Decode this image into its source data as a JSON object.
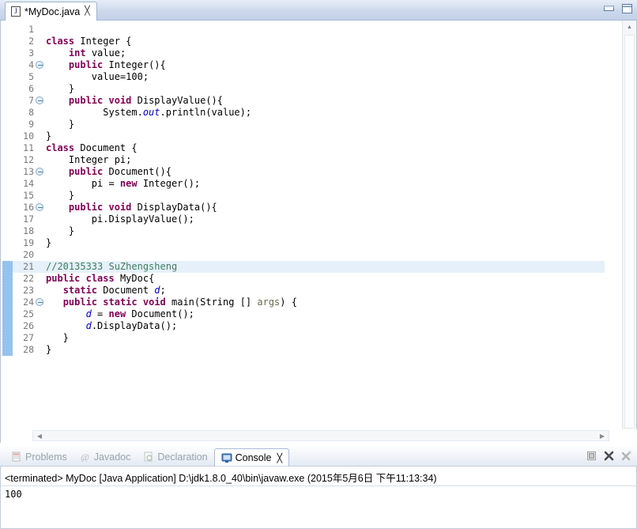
{
  "window": {
    "minimize_label": "minimize-window",
    "maximize_label": "maximize-window"
  },
  "editor_tab": {
    "icon": "java-file-icon",
    "icon_glyph": "J",
    "title": "*MyDoc.java",
    "close_glyph": "╳"
  },
  "editor": {
    "current_line": 21,
    "changed_lines": {
      "from": 21,
      "to": 28
    },
    "folding_markers": [
      4,
      7,
      13,
      16,
      24
    ],
    "line_numbers": [
      1,
      2,
      3,
      4,
      5,
      6,
      7,
      8,
      9,
      10,
      11,
      12,
      13,
      14,
      15,
      16,
      17,
      18,
      19,
      20,
      21,
      22,
      23,
      24,
      25,
      26,
      27,
      28
    ],
    "lines": [
      {
        "n": 1,
        "tokens": []
      },
      {
        "n": 2,
        "tokens": [
          {
            "t": "class",
            "c": "kw"
          },
          {
            "t": " Integer {",
            "c": ""
          }
        ]
      },
      {
        "n": 3,
        "tokens": [
          {
            "t": "    ",
            "c": ""
          },
          {
            "t": "int",
            "c": "kw"
          },
          {
            "t": " value;",
            "c": ""
          }
        ]
      },
      {
        "n": 4,
        "tokens": [
          {
            "t": "    ",
            "c": ""
          },
          {
            "t": "public",
            "c": "kw"
          },
          {
            "t": " Integer(){",
            "c": ""
          }
        ]
      },
      {
        "n": 5,
        "tokens": [
          {
            "t": "        value=100;",
            "c": ""
          }
        ]
      },
      {
        "n": 6,
        "tokens": [
          {
            "t": "    }",
            "c": ""
          }
        ]
      },
      {
        "n": 7,
        "tokens": [
          {
            "t": "    ",
            "c": ""
          },
          {
            "t": "public",
            "c": "kw"
          },
          {
            "t": " ",
            "c": ""
          },
          {
            "t": "void",
            "c": "kw"
          },
          {
            "t": " DisplayValue(){",
            "c": ""
          }
        ]
      },
      {
        "n": 8,
        "tokens": [
          {
            "t": "          System.",
            "c": ""
          },
          {
            "t": "out",
            "c": "fld"
          },
          {
            "t": ".println(value);",
            "c": ""
          }
        ]
      },
      {
        "n": 9,
        "tokens": [
          {
            "t": "    }",
            "c": ""
          }
        ]
      },
      {
        "n": 10,
        "tokens": [
          {
            "t": "}",
            "c": ""
          }
        ]
      },
      {
        "n": 11,
        "tokens": [
          {
            "t": "class",
            "c": "kw"
          },
          {
            "t": " Document {",
            "c": ""
          }
        ]
      },
      {
        "n": 12,
        "tokens": [
          {
            "t": "    Integer pi;",
            "c": ""
          }
        ]
      },
      {
        "n": 13,
        "tokens": [
          {
            "t": "    ",
            "c": ""
          },
          {
            "t": "public",
            "c": "kw"
          },
          {
            "t": " Document(){",
            "c": ""
          }
        ]
      },
      {
        "n": 14,
        "tokens": [
          {
            "t": "        pi = ",
            "c": ""
          },
          {
            "t": "new",
            "c": "kw"
          },
          {
            "t": " Integer();",
            "c": ""
          }
        ]
      },
      {
        "n": 15,
        "tokens": [
          {
            "t": "    }",
            "c": ""
          }
        ]
      },
      {
        "n": 16,
        "tokens": [
          {
            "t": "    ",
            "c": ""
          },
          {
            "t": "public",
            "c": "kw"
          },
          {
            "t": " ",
            "c": ""
          },
          {
            "t": "void",
            "c": "kw"
          },
          {
            "t": " DisplayData(){",
            "c": ""
          }
        ]
      },
      {
        "n": 17,
        "tokens": [
          {
            "t": "        pi.DisplayValue();",
            "c": ""
          }
        ]
      },
      {
        "n": 18,
        "tokens": [
          {
            "t": "    }",
            "c": ""
          }
        ]
      },
      {
        "n": 19,
        "tokens": [
          {
            "t": "}",
            "c": ""
          }
        ]
      },
      {
        "n": 20,
        "tokens": []
      },
      {
        "n": 21,
        "tokens": [
          {
            "t": "//20135333 SuZhengsheng",
            "c": "cmt"
          }
        ]
      },
      {
        "n": 22,
        "tokens": [
          {
            "t": "public",
            "c": "kw"
          },
          {
            "t": " ",
            "c": ""
          },
          {
            "t": "class",
            "c": "kw"
          },
          {
            "t": " MyDoc{",
            "c": ""
          }
        ]
      },
      {
        "n": 23,
        "tokens": [
          {
            "t": "   ",
            "c": ""
          },
          {
            "t": "static",
            "c": "kw"
          },
          {
            "t": " Document ",
            "c": ""
          },
          {
            "t": "d",
            "c": "fld"
          },
          {
            "t": ";",
            "c": ""
          }
        ]
      },
      {
        "n": 24,
        "tokens": [
          {
            "t": "   ",
            "c": ""
          },
          {
            "t": "public",
            "c": "kw"
          },
          {
            "t": " ",
            "c": ""
          },
          {
            "t": "static",
            "c": "kw"
          },
          {
            "t": " ",
            "c": ""
          },
          {
            "t": "void",
            "c": "kw"
          },
          {
            "t": " main(String [] ",
            "c": ""
          },
          {
            "t": "args",
            "c": "par"
          },
          {
            "t": ") {",
            "c": ""
          }
        ]
      },
      {
        "n": 25,
        "tokens": [
          {
            "t": "       ",
            "c": ""
          },
          {
            "t": "d",
            "c": "fld"
          },
          {
            "t": " = ",
            "c": ""
          },
          {
            "t": "new",
            "c": "kw"
          },
          {
            "t": " Document();",
            "c": ""
          }
        ]
      },
      {
        "n": 26,
        "tokens": [
          {
            "t": "       ",
            "c": ""
          },
          {
            "t": "d",
            "c": "fld"
          },
          {
            "t": ".DisplayData();",
            "c": ""
          }
        ]
      },
      {
        "n": 27,
        "tokens": [
          {
            "t": "   }",
            "c": ""
          }
        ]
      },
      {
        "n": 28,
        "tokens": [
          {
            "t": "}",
            "c": ""
          }
        ]
      }
    ]
  },
  "bottom_tabs": [
    {
      "label": "Problems",
      "icon": "problems-icon",
      "active": false
    },
    {
      "label": "Javadoc",
      "icon": "javadoc-icon",
      "active": false
    },
    {
      "label": "Declaration",
      "icon": "declaration-icon",
      "active": false
    },
    {
      "label": "Console",
      "icon": "console-icon",
      "active": true,
      "close_glyph": "╳"
    }
  ],
  "console_tools": [
    {
      "name": "stop-button",
      "tooltip": "Stop"
    },
    {
      "name": "remove-launch-button",
      "tooltip": "Remove Launch"
    },
    {
      "name": "remove-all-launches-button",
      "tooltip": "Remove All Terminated Launches"
    }
  ],
  "console": {
    "header": "<terminated> MyDoc [Java Application] D:\\jdk1.8.0_40\\bin\\javaw.exe (2015年5月6日 下午11:13:34)",
    "output": "100"
  },
  "colors": {
    "keyword": "#7f0055",
    "comment": "#3f7f5f",
    "field": "#0000c0",
    "parameter": "#6a6a4a",
    "current_line_highlight": "#e6f0fa",
    "changed_marker": "#2c86d9",
    "tabbar": "#ccd8ec"
  }
}
